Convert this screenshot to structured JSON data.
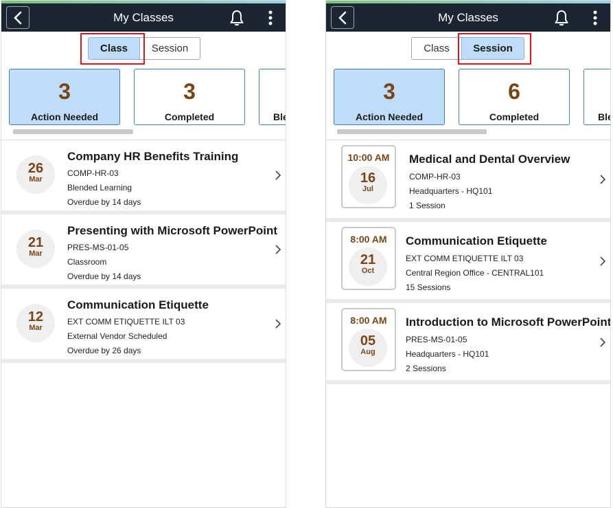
{
  "colors": {
    "header_bg": "#1d2533",
    "active_bg": "#bfdcf8",
    "accent_brown": "#7a4416",
    "highlight_red": "#e0151b"
  },
  "left": {
    "title": "My Classes",
    "segments": [
      "Class",
      "Session"
    ],
    "active_segment": "Class",
    "tiles": [
      {
        "count": "3",
        "label": "Action Needed",
        "active": true
      },
      {
        "count": "3",
        "label": "Completed",
        "active": false
      },
      {
        "count": "",
        "label": "Ble",
        "active": false
      }
    ],
    "items": [
      {
        "day": "26",
        "month": "Mar",
        "title": "Company HR Benefits Training",
        "line1": "COMP-HR-03",
        "line2": "Blended Learning",
        "line3": "Overdue by 14 days"
      },
      {
        "day": "21",
        "month": "Mar",
        "title": "Presenting with Microsoft PowerPoint",
        "line1": "PRES-MS-01-05",
        "line2": "Classroom",
        "line3": "Overdue by 14 days"
      },
      {
        "day": "12",
        "month": "Mar",
        "title": "Communication Etiquette",
        "line1": "EXT COMM ETIQUETTE ILT 03",
        "line2": "External Vendor Scheduled",
        "line3": "Overdue by 26 days"
      }
    ]
  },
  "right": {
    "title": "My Classes",
    "segments": [
      "Class",
      "Session"
    ],
    "active_segment": "Session",
    "tiles": [
      {
        "count": "3",
        "label": "Action Needed",
        "active": true
      },
      {
        "count": "6",
        "label": "Completed",
        "active": false
      },
      {
        "count": "",
        "label": "Ble",
        "active": false
      }
    ],
    "items": [
      {
        "time": "10:00 AM",
        "day": "16",
        "month": "Jul",
        "title": "Medical and Dental Overview",
        "line1": "COMP-HR-03",
        "line2": "Headquarters - HQ101",
        "line3": "1 Session"
      },
      {
        "time": "8:00 AM",
        "day": "21",
        "month": "Oct",
        "title": "Communication Etiquette",
        "line1": "EXT COMM ETIQUETTE ILT 03",
        "line2": "Central Region Office - CENTRAL101",
        "line3": "15 Sessions"
      },
      {
        "time": "8:00 AM",
        "day": "05",
        "month": "Aug",
        "title": "Introduction to Microsoft PowerPoint",
        "line1": "PRES-MS-01-05",
        "line2": "Headquarters - HQ101",
        "line3": "2 Sessions"
      }
    ]
  }
}
